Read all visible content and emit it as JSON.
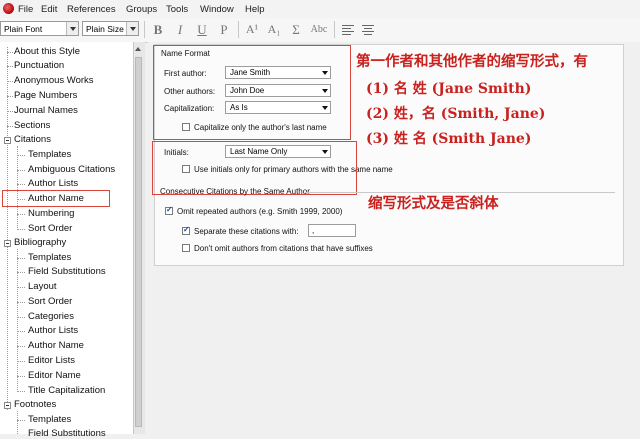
{
  "menubar": {
    "items": [
      "File",
      "Edit",
      "References",
      "Groups",
      "Tools",
      "Window",
      "Help"
    ]
  },
  "toolbar": {
    "font_select": "Plain Font",
    "size_select": "Plain Size",
    "bold": "B",
    "italic": "I",
    "underline": "U",
    "plain": "P",
    "superscript": "A¹",
    "subscript": "A₁",
    "symbol": "Σ",
    "small_caps": "Abc"
  },
  "sidebar": {
    "items": [
      "About this Style",
      "Punctuation",
      "Anonymous Works",
      "Page Numbers",
      "Journal Names",
      "Sections",
      "Citations",
      "Templates",
      "Ambiguous Citations",
      "Author Lists",
      "Author Name",
      "Numbering",
      "Sort Order",
      "Bibliography",
      "Templates",
      "Field Substitutions",
      "Layout",
      "Sort Order",
      "Categories",
      "Author Lists",
      "Author Name",
      "Editor Lists",
      "Editor Name",
      "Title Capitalization",
      "Footnotes",
      "Templates",
      "Field Substitutions"
    ],
    "selected": "Author Name"
  },
  "name_format": {
    "group_title": "Name Format",
    "first_author_label": "First author:",
    "first_author_value": "Jane Smith",
    "other_authors_label": "Other authors:",
    "other_authors_value": "John Doe",
    "capitalization_label": "Capitalization:",
    "capitalization_value": "As Is",
    "capitalize_last_name": "Capitalize only the author's last name"
  },
  "initials": {
    "label": "Initials:",
    "value": "Last Name Only",
    "primary_only": "Use initials only for primary authors with the same name"
  },
  "consecutive": {
    "group_title": "Consecutive Citations by the Same Author",
    "omit_repeated": "Omit repeated authors (e.g. Smith 1999, 2000)",
    "separate_with": "Separate these citations with:",
    "separator_value": ",",
    "dont_omit": "Don't omit authors from citations that have suffixes"
  },
  "annotations": {
    "line1": "第一作者和其他作者的缩写形式，有",
    "line2": "(1) 名 姓 (Jane Smith)",
    "line3": "(2) 姓，名 (Smith, Jane)",
    "line4": "(3) 姓 名 (Smith Jane)",
    "line5": "缩写形式及是否斜体"
  },
  "colors": {
    "annotation_red": "#c9211e",
    "highlight_box": "#d9463c",
    "check_blue": "#1a4ea0"
  }
}
